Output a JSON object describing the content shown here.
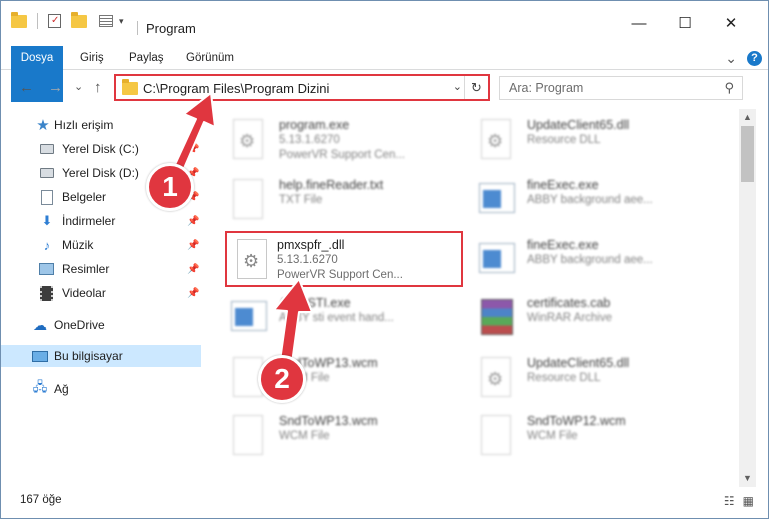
{
  "window": {
    "title": "Program",
    "minimize_glyph": "—",
    "maximize_glyph": "☐",
    "close_glyph": "✕"
  },
  "ribbon": {
    "tabs": [
      "Dosya",
      "Giriş",
      "Paylaş",
      "Görünüm"
    ],
    "expand_glyph": "⌄",
    "help_glyph": "?"
  },
  "navigation": {
    "back_glyph": "←",
    "forward_glyph": "→",
    "recent_glyph": "⌄",
    "up_glyph": "↑",
    "address": "C:\\Program Files\\Program Dizini",
    "address_dropdown_glyph": "⌄",
    "refresh_glyph": "↻",
    "search_placeholder": "Ara: Program",
    "search_glyph": "⚲"
  },
  "sidebar": {
    "items": [
      {
        "label": "Hızlı erişim",
        "icon": "star-icon",
        "pinned": false
      },
      {
        "label": "Yerel Disk (C:)",
        "icon": "drive-icon",
        "pinned": true
      },
      {
        "label": "Yerel Disk (D:)",
        "icon": "drive-icon",
        "pinned": true
      },
      {
        "label": "Belgeler",
        "icon": "documents-icon",
        "pinned": true
      },
      {
        "label": "İndirmeler",
        "icon": "download-icon",
        "pinned": true
      },
      {
        "label": "Müzik",
        "icon": "music-icon",
        "pinned": true
      },
      {
        "label": "Resimler",
        "icon": "pictures-icon",
        "pinned": true
      },
      {
        "label": "Videolar",
        "icon": "videos-icon",
        "pinned": true
      },
      {
        "label": "OneDrive",
        "icon": "onedrive-icon",
        "pinned": false
      },
      {
        "label": "Bu bilgisayar",
        "icon": "pc-icon",
        "pinned": false,
        "selected": true
      },
      {
        "label": "Ağ",
        "icon": "network-icon",
        "pinned": false
      }
    ],
    "pin_glyph": "📌"
  },
  "files": [
    {
      "name": "program.exe",
      "line2": "5.13.1.6270",
      "line3": "PowerVR Support Cen...",
      "icon": "app-icon",
      "blurred": true
    },
    {
      "name": "UpdateClient65.dll",
      "line2": "Resource DLL",
      "line3": "",
      "icon": "dll-gear-icon",
      "blurred": true
    },
    {
      "name": "help.fineReader.txt",
      "line2": "TXT File",
      "line3": "",
      "icon": "text-file-icon",
      "blurred": true
    },
    {
      "name": "fineExec.exe",
      "line2": "ABBY background aee...",
      "line3": "",
      "icon": "app-window-icon",
      "blurred": true
    },
    {
      "name": "pmxspfr_.dll",
      "line2": "5.13.1.6270",
      "line3": "PowerVR Support Cen...",
      "icon": "dll-gear-icon",
      "blurred": false,
      "highlighted": true
    },
    {
      "name": "fineExec.exe",
      "line2": "ABBY background aee...",
      "line3": "",
      "icon": "app-window-icon",
      "blurred": true
    },
    {
      "name": "AbbySTI.exe",
      "line2": "ABBY sti event hand...",
      "line3": "",
      "icon": "app-window-icon",
      "blurred": true
    },
    {
      "name": "certificates.cab",
      "line2": "WinRAR Archive",
      "line3": "",
      "icon": "winrar-icon",
      "blurred": true
    },
    {
      "name": "SndToWP13.wcm",
      "line2": "WCM File",
      "line3": "",
      "icon": "blank-file-icon",
      "blurred": true
    },
    {
      "name": "UpdateClient65.dll",
      "line2": "Resource DLL",
      "line3": "",
      "icon": "dll-gear-icon",
      "blurred": true
    },
    {
      "name": "SndToWP13.wcm",
      "line2": "WCM File",
      "line3": "",
      "icon": "blank-file-icon",
      "blurred": true
    },
    {
      "name": "SndToWP12.wcm",
      "line2": "WCM File",
      "line3": "",
      "icon": "blank-file-icon",
      "blurred": true
    }
  ],
  "scrollbar": {
    "up_glyph": "▲",
    "down_glyph": "▼"
  },
  "status": {
    "item_count": "167 öğe",
    "details_view_glyph": "☷",
    "icons_view_glyph": "▦"
  },
  "callouts": [
    {
      "number": "1",
      "color": "#e0363f"
    },
    {
      "number": "2",
      "color": "#e0363f"
    }
  ]
}
